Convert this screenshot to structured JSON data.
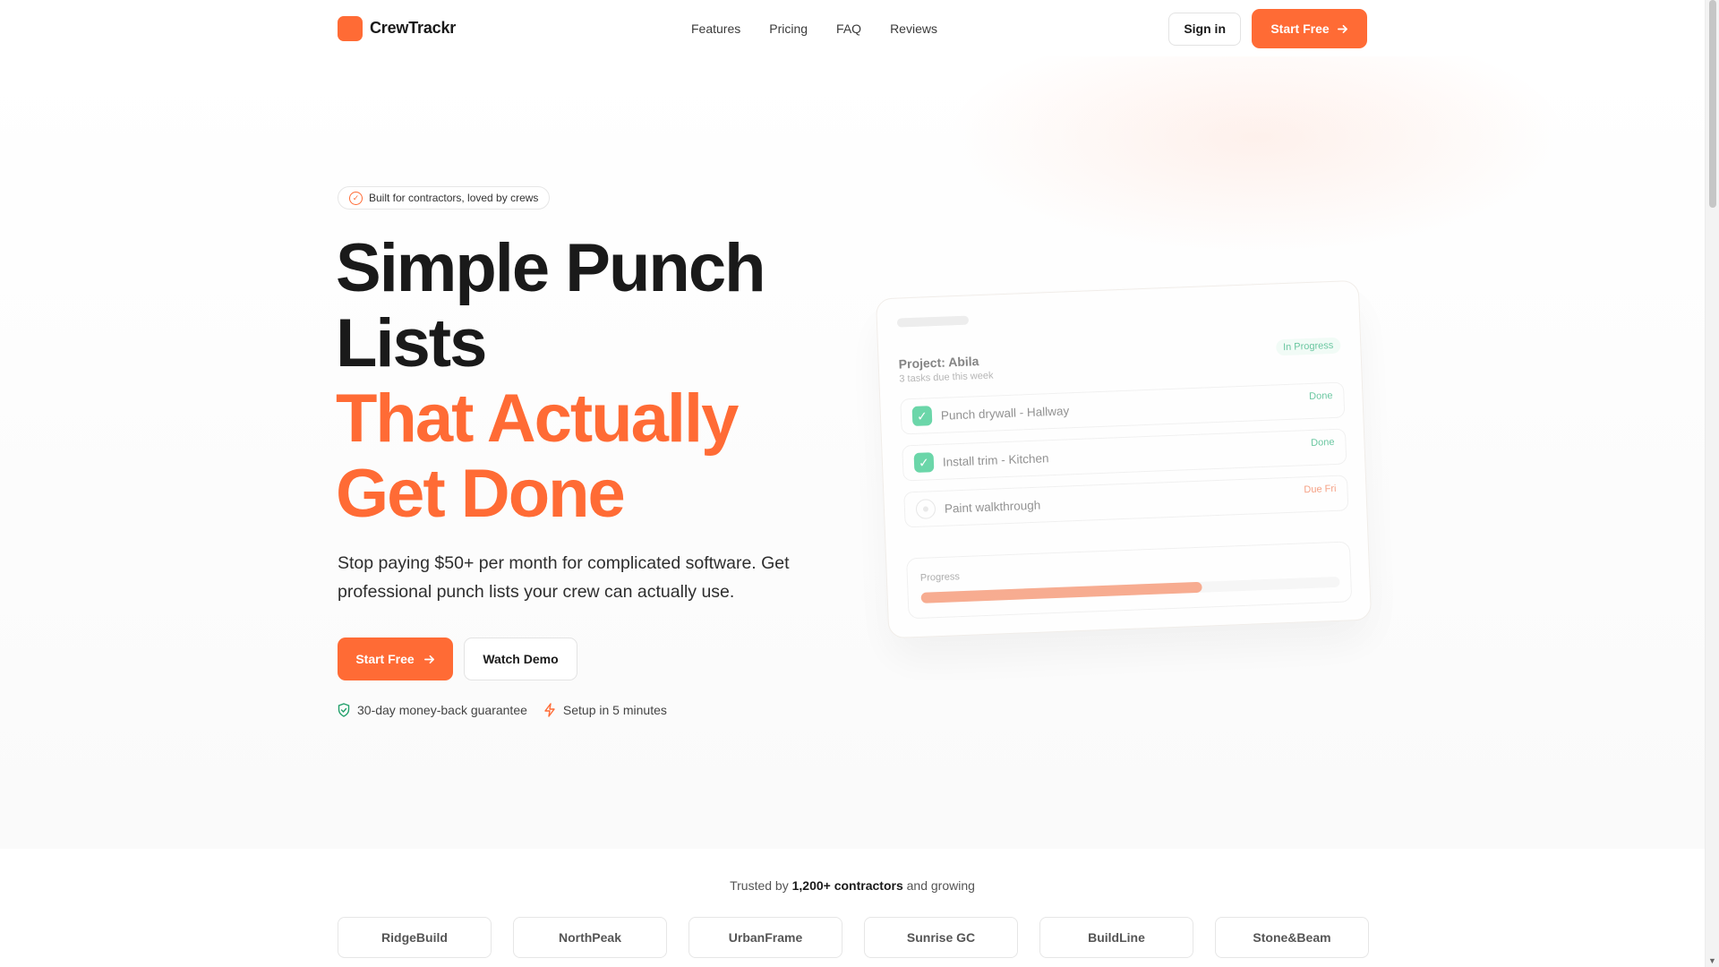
{
  "brand": {
    "name": "CrewTrackr",
    "accent": "#ff6b35"
  },
  "nav": {
    "items": [
      "Features",
      "Pricing",
      "FAQ",
      "Reviews"
    ]
  },
  "header": {
    "signin_label": "Sign in",
    "start_label": "Start Free"
  },
  "hero": {
    "badge": "Built for contractors, loved by crews",
    "headline_line1": "Simple Punch",
    "headline_line2": "Lists",
    "headline_line3": "That Actually",
    "headline_line4": "Get Done",
    "subtext": "Stop paying $50+ per month for complicated software. Get professional punch lists your crew can actually use.",
    "cta_primary": "Start Free",
    "cta_secondary": "Watch Demo",
    "trust_1": "30-day money-back guarantee",
    "trust_2": "Setup in 5 minutes"
  },
  "card": {
    "title": "Project: Abila",
    "subtitle": "3 tasks due this week",
    "status": "In Progress",
    "tasks": [
      {
        "label": "Punch drywall - Hallway",
        "tag": "Done",
        "done": true
      },
      {
        "label": "Install trim - Kitchen",
        "tag": "Done",
        "done": true
      },
      {
        "label": "Paint walkthrough",
        "tag": "Due Fri",
        "done": false
      }
    ],
    "progress_label": "Progress",
    "progress_fraction": 0.67
  },
  "trusted": {
    "prefix": "Trusted by ",
    "count": "1,200+ contractors",
    "suffix": " and growing",
    "logos": [
      "RidgeBuild",
      "NorthPeak",
      "UrbanFrame",
      "Sunrise GC",
      "BuildLine",
      "Stone&Beam"
    ]
  }
}
